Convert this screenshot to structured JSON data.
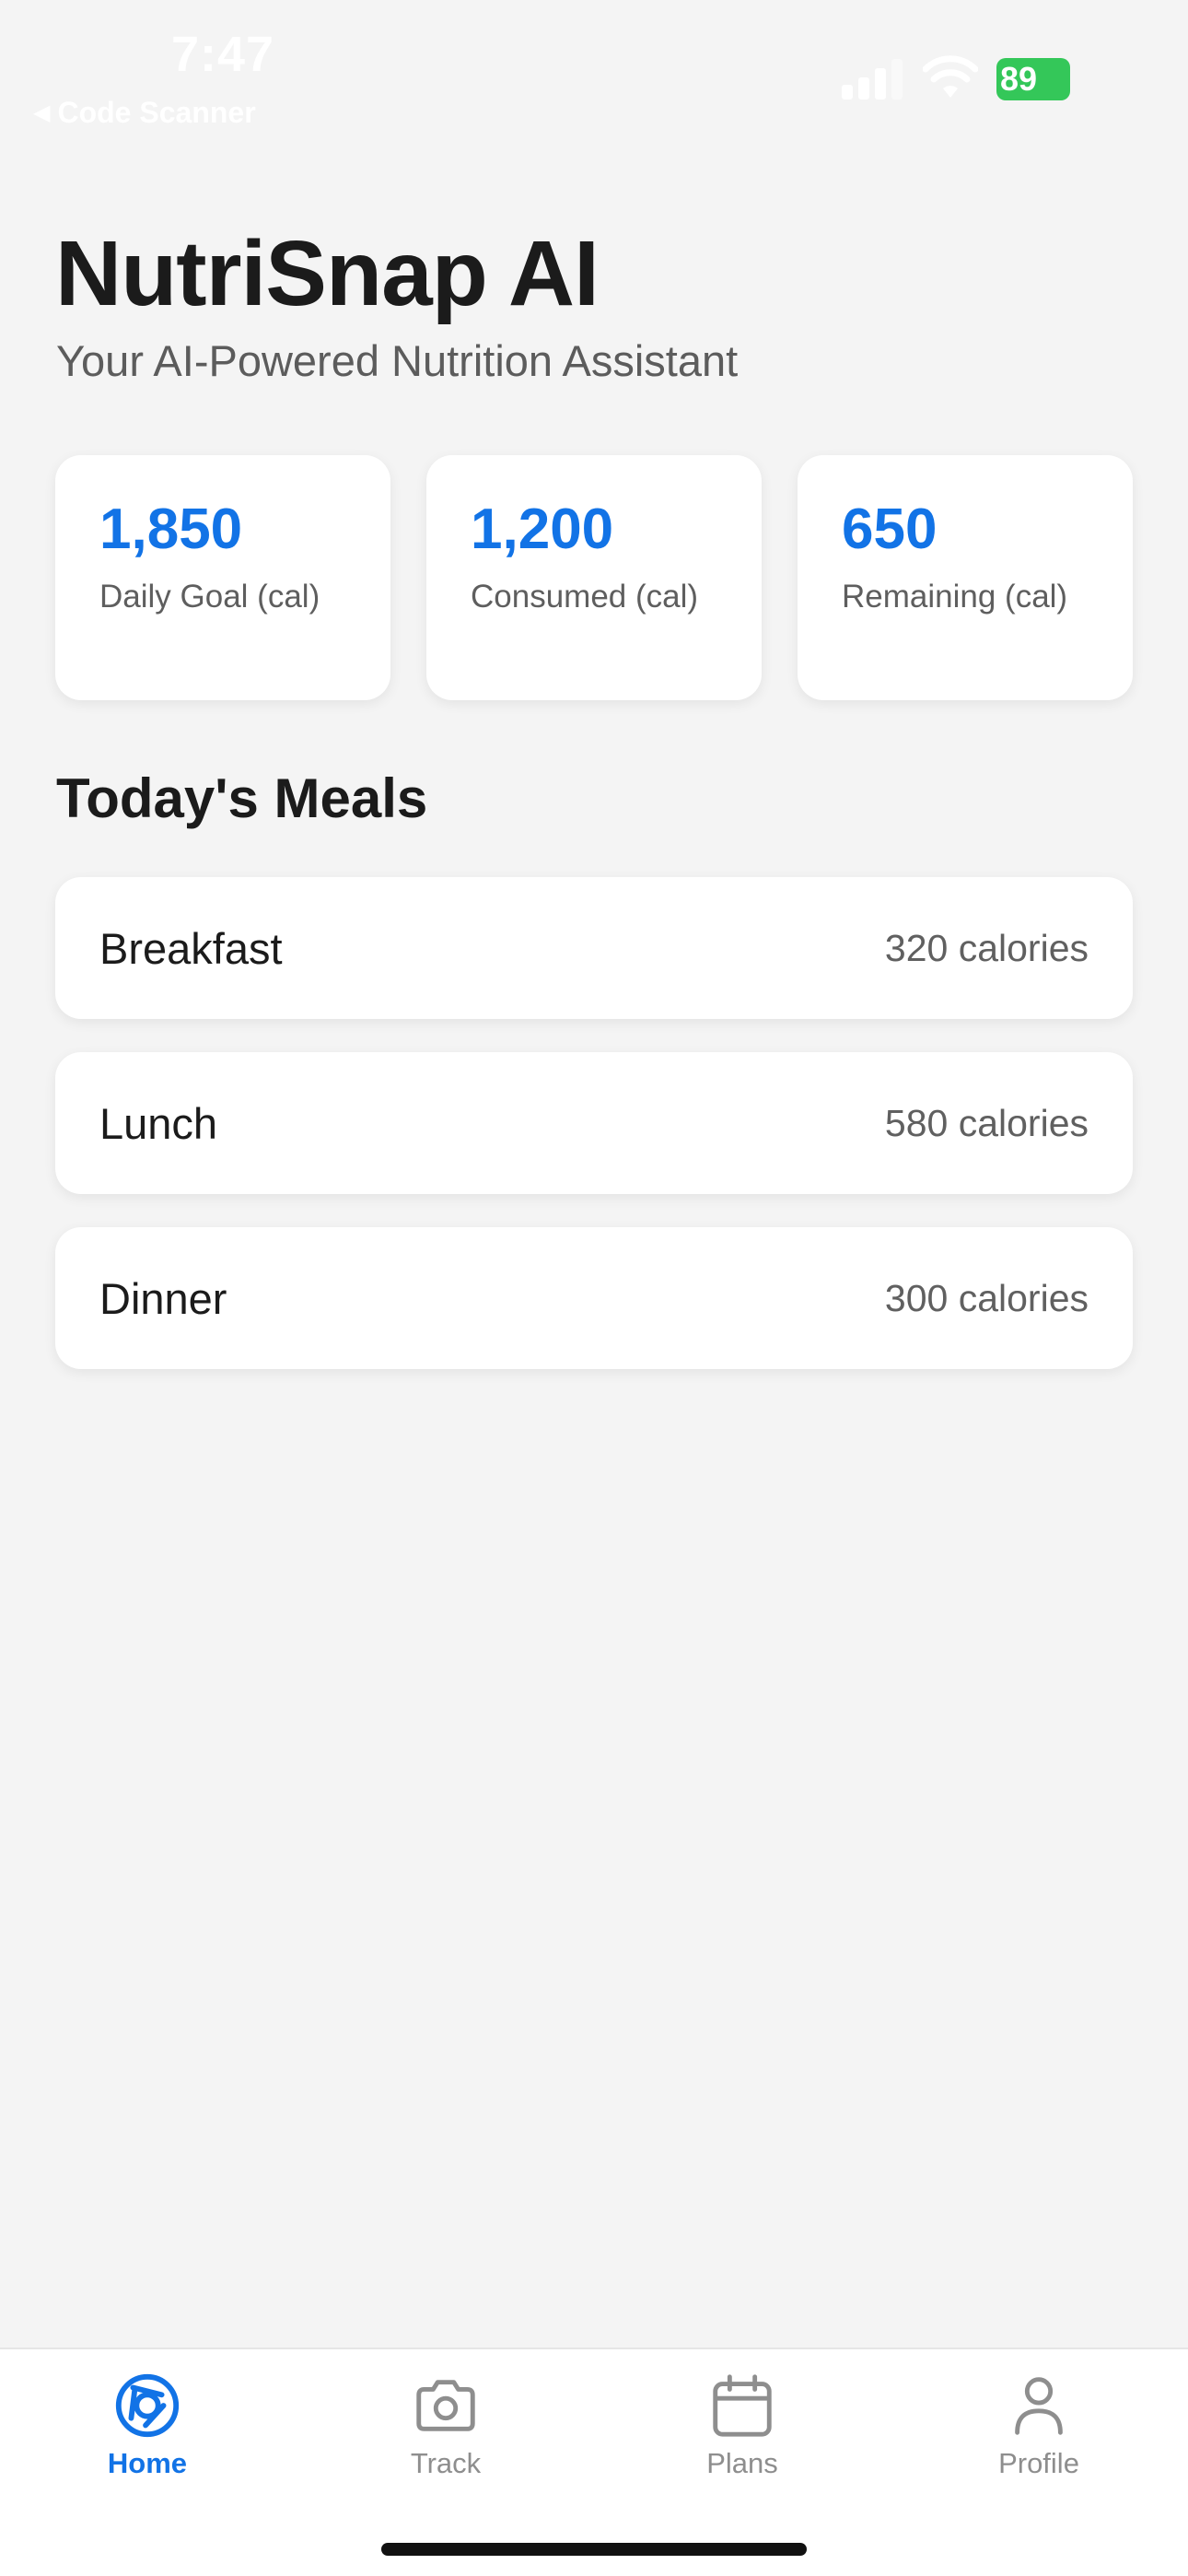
{
  "status_bar": {
    "time": "7:47",
    "back_label": "Code Scanner",
    "battery": "89"
  },
  "header": {
    "title": "NutriSnap AI",
    "subtitle": "Your AI-Powered Nutrition Assistant"
  },
  "stats": [
    {
      "value": "1,850",
      "label": "Daily Goal (cal)"
    },
    {
      "value": "1,200",
      "label": "Consumed (cal)"
    },
    {
      "value": "650",
      "label": "Remaining (cal)"
    }
  ],
  "meals": {
    "title": "Today's Meals",
    "items": [
      {
        "name": "Breakfast",
        "calories": "320 calories"
      },
      {
        "name": "Lunch",
        "calories": "580 calories"
      },
      {
        "name": "Dinner",
        "calories": "300 calories"
      }
    ]
  },
  "tab_bar": {
    "tabs": [
      {
        "label": "Home",
        "icon": "home-aperture-icon",
        "active": true
      },
      {
        "label": "Track",
        "icon": "camera-icon",
        "active": false
      },
      {
        "label": "Plans",
        "icon": "calendar-icon",
        "active": false
      },
      {
        "label": "Profile",
        "icon": "person-icon",
        "active": false
      }
    ]
  },
  "colors": {
    "accent": "#1273e6",
    "background": "#f4f4f4",
    "card": "#ffffff",
    "battery": "#34c759",
    "inactive_tab": "#8e8e8e"
  }
}
